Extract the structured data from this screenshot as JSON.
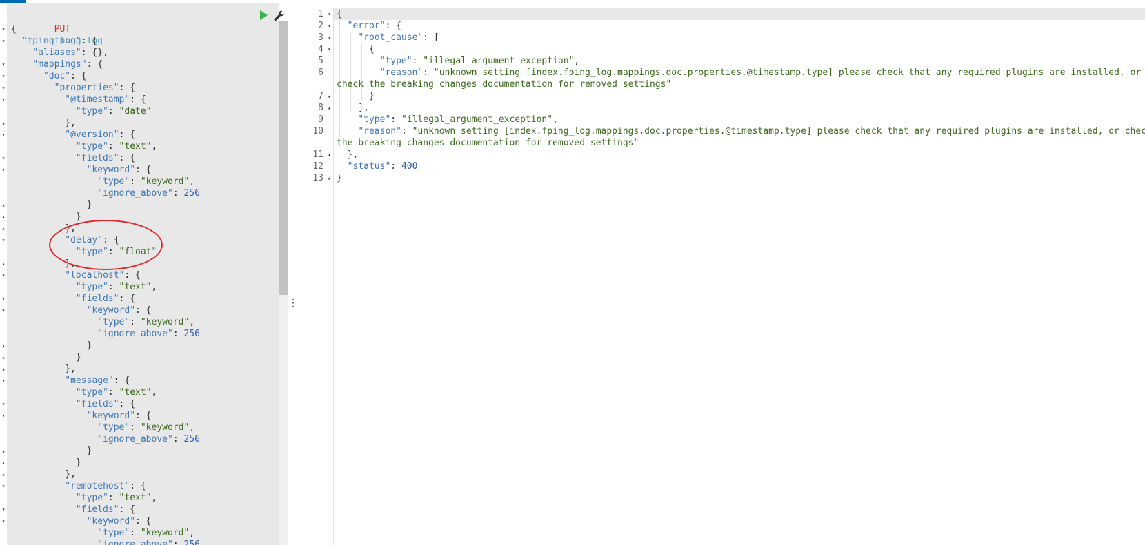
{
  "request": {
    "method": "PUT",
    "path": "fping_log",
    "run_icon": "play-icon",
    "settings_icon": "wrench-icon",
    "lines": [
      {
        "fold": "open",
        "parts": [
          [
            "p",
            "{"
          ]
        ]
      },
      {
        "fold": "open",
        "parts": [
          [
            "p",
            "  "
          ],
          [
            "k",
            "\"fping_log\""
          ],
          [
            "p",
            ": {"
          ]
        ]
      },
      {
        "fold": "",
        "parts": [
          [
            "p",
            "    "
          ],
          [
            "k",
            "\"aliases\""
          ],
          [
            "p",
            ": {},"
          ]
        ]
      },
      {
        "fold": "open",
        "parts": [
          [
            "p",
            "    "
          ],
          [
            "k",
            "\"mappings\""
          ],
          [
            "p",
            ": {"
          ]
        ]
      },
      {
        "fold": "open",
        "parts": [
          [
            "p",
            "      "
          ],
          [
            "k",
            "\"doc\""
          ],
          [
            "p",
            ": {"
          ]
        ]
      },
      {
        "fold": "open",
        "parts": [
          [
            "p",
            "        "
          ],
          [
            "k",
            "\"properties\""
          ],
          [
            "p",
            ": {"
          ]
        ]
      },
      {
        "fold": "open",
        "parts": [
          [
            "p",
            "          "
          ],
          [
            "k",
            "\"@timestamp\""
          ],
          [
            "p",
            ": {"
          ]
        ]
      },
      {
        "fold": "",
        "parts": [
          [
            "p",
            "            "
          ],
          [
            "k",
            "\"type\""
          ],
          [
            "p",
            ": "
          ],
          [
            "s",
            "\"date\""
          ]
        ]
      },
      {
        "fold": "close",
        "parts": [
          [
            "p",
            "          },"
          ]
        ]
      },
      {
        "fold": "open",
        "parts": [
          [
            "p",
            "          "
          ],
          [
            "k",
            "\"@version\""
          ],
          [
            "p",
            ": {"
          ]
        ]
      },
      {
        "fold": "",
        "parts": [
          [
            "p",
            "            "
          ],
          [
            "k",
            "\"type\""
          ],
          [
            "p",
            ": "
          ],
          [
            "s",
            "\"text\""
          ],
          [
            "p",
            ","
          ]
        ]
      },
      {
        "fold": "open",
        "parts": [
          [
            "p",
            "            "
          ],
          [
            "k",
            "\"fields\""
          ],
          [
            "p",
            ": {"
          ]
        ]
      },
      {
        "fold": "open",
        "parts": [
          [
            "p",
            "              "
          ],
          [
            "k",
            "\"keyword\""
          ],
          [
            "p",
            ": {"
          ]
        ]
      },
      {
        "fold": "",
        "parts": [
          [
            "p",
            "                "
          ],
          [
            "k",
            "\"type\""
          ],
          [
            "p",
            ": "
          ],
          [
            "s",
            "\"keyword\""
          ],
          [
            "p",
            ","
          ]
        ]
      },
      {
        "fold": "",
        "parts": [
          [
            "p",
            "                "
          ],
          [
            "k",
            "\"ignore_above\""
          ],
          [
            "p",
            ": "
          ],
          [
            "n",
            "256"
          ]
        ]
      },
      {
        "fold": "close",
        "parts": [
          [
            "p",
            "              }"
          ]
        ]
      },
      {
        "fold": "close",
        "parts": [
          [
            "p",
            "            }"
          ]
        ]
      },
      {
        "fold": "close",
        "parts": [
          [
            "p",
            "          },"
          ]
        ]
      },
      {
        "fold": "open",
        "parts": [
          [
            "p",
            "          "
          ],
          [
            "k",
            "\"delay\""
          ],
          [
            "p",
            ": {"
          ]
        ]
      },
      {
        "fold": "",
        "parts": [
          [
            "p",
            "            "
          ],
          [
            "k",
            "\"type\""
          ],
          [
            "p",
            ": "
          ],
          [
            "s",
            "\"float\""
          ]
        ]
      },
      {
        "fold": "close",
        "parts": [
          [
            "p",
            "          },"
          ]
        ]
      },
      {
        "fold": "open",
        "parts": [
          [
            "p",
            "          "
          ],
          [
            "k",
            "\"localhost\""
          ],
          [
            "p",
            ": {"
          ]
        ]
      },
      {
        "fold": "",
        "parts": [
          [
            "p",
            "            "
          ],
          [
            "k",
            "\"type\""
          ],
          [
            "p",
            ": "
          ],
          [
            "s",
            "\"text\""
          ],
          [
            "p",
            ","
          ]
        ]
      },
      {
        "fold": "open",
        "parts": [
          [
            "p",
            "            "
          ],
          [
            "k",
            "\"fields\""
          ],
          [
            "p",
            ": {"
          ]
        ]
      },
      {
        "fold": "open",
        "parts": [
          [
            "p",
            "              "
          ],
          [
            "k",
            "\"keyword\""
          ],
          [
            "p",
            ": {"
          ]
        ]
      },
      {
        "fold": "",
        "parts": [
          [
            "p",
            "                "
          ],
          [
            "k",
            "\"type\""
          ],
          [
            "p",
            ": "
          ],
          [
            "s",
            "\"keyword\""
          ],
          [
            "p",
            ","
          ]
        ]
      },
      {
        "fold": "",
        "parts": [
          [
            "p",
            "                "
          ],
          [
            "k",
            "\"ignore_above\""
          ],
          [
            "p",
            ": "
          ],
          [
            "n",
            "256"
          ]
        ]
      },
      {
        "fold": "close",
        "parts": [
          [
            "p",
            "              }"
          ]
        ]
      },
      {
        "fold": "close",
        "parts": [
          [
            "p",
            "            }"
          ]
        ]
      },
      {
        "fold": "close",
        "parts": [
          [
            "p",
            "          },"
          ]
        ]
      },
      {
        "fold": "open",
        "parts": [
          [
            "p",
            "          "
          ],
          [
            "k",
            "\"message\""
          ],
          [
            "p",
            ": {"
          ]
        ]
      },
      {
        "fold": "",
        "parts": [
          [
            "p",
            "            "
          ],
          [
            "k",
            "\"type\""
          ],
          [
            "p",
            ": "
          ],
          [
            "s",
            "\"text\""
          ],
          [
            "p",
            ","
          ]
        ]
      },
      {
        "fold": "open",
        "parts": [
          [
            "p",
            "            "
          ],
          [
            "k",
            "\"fields\""
          ],
          [
            "p",
            ": {"
          ]
        ]
      },
      {
        "fold": "open",
        "parts": [
          [
            "p",
            "              "
          ],
          [
            "k",
            "\"keyword\""
          ],
          [
            "p",
            ": {"
          ]
        ]
      },
      {
        "fold": "",
        "parts": [
          [
            "p",
            "                "
          ],
          [
            "k",
            "\"type\""
          ],
          [
            "p",
            ": "
          ],
          [
            "s",
            "\"keyword\""
          ],
          [
            "p",
            ","
          ]
        ]
      },
      {
        "fold": "",
        "parts": [
          [
            "p",
            "                "
          ],
          [
            "k",
            "\"ignore_above\""
          ],
          [
            "p",
            ": "
          ],
          [
            "n",
            "256"
          ]
        ]
      },
      {
        "fold": "close",
        "parts": [
          [
            "p",
            "              }"
          ]
        ]
      },
      {
        "fold": "close",
        "parts": [
          [
            "p",
            "            }"
          ]
        ]
      },
      {
        "fold": "close",
        "parts": [
          [
            "p",
            "          },"
          ]
        ]
      },
      {
        "fold": "open",
        "parts": [
          [
            "p",
            "          "
          ],
          [
            "k",
            "\"remotehost\""
          ],
          [
            "p",
            ": {"
          ]
        ]
      },
      {
        "fold": "",
        "parts": [
          [
            "p",
            "            "
          ],
          [
            "k",
            "\"type\""
          ],
          [
            "p",
            ": "
          ],
          [
            "s",
            "\"text\""
          ],
          [
            "p",
            ","
          ]
        ]
      },
      {
        "fold": "open",
        "parts": [
          [
            "p",
            "            "
          ],
          [
            "k",
            "\"fields\""
          ],
          [
            "p",
            ": {"
          ]
        ]
      },
      {
        "fold": "open",
        "parts": [
          [
            "p",
            "              "
          ],
          [
            "k",
            "\"keyword\""
          ],
          [
            "p",
            ": {"
          ]
        ]
      },
      {
        "fold": "",
        "parts": [
          [
            "p",
            "                "
          ],
          [
            "k",
            "\"type\""
          ],
          [
            "p",
            ": "
          ],
          [
            "s",
            "\"keyword\""
          ],
          [
            "p",
            ","
          ]
        ]
      },
      {
        "fold": "",
        "parts": [
          [
            "p",
            "                "
          ],
          [
            "k",
            "\"ignore_above\""
          ],
          [
            "p",
            ": "
          ],
          [
            "n",
            "256"
          ]
        ]
      }
    ]
  },
  "response": {
    "lines": [
      {
        "num": "1",
        "fold": "open",
        "parts": [
          [
            "p",
            "{"
          ]
        ]
      },
      {
        "num": "2",
        "fold": "open",
        "parts": [
          [
            "p",
            "  "
          ],
          [
            "k",
            "\"error\""
          ],
          [
            "p",
            ": {"
          ]
        ]
      },
      {
        "num": "3",
        "fold": "open",
        "parts": [
          [
            "p",
            "    "
          ],
          [
            "k",
            "\"root_cause\""
          ],
          [
            "p",
            ": ["
          ]
        ]
      },
      {
        "num": "4",
        "fold": "open",
        "parts": [
          [
            "p",
            "      {"
          ]
        ]
      },
      {
        "num": "5",
        "fold": "",
        "parts": [
          [
            "p",
            "        "
          ],
          [
            "k",
            "\"type\""
          ],
          [
            "p",
            ": "
          ],
          [
            "s",
            "\"illegal_argument_exception\""
          ],
          [
            "p",
            ","
          ]
        ]
      },
      {
        "num": "6",
        "fold": "",
        "parts": [
          [
            "p",
            "        "
          ],
          [
            "k",
            "\"reason\""
          ],
          [
            "p",
            ": "
          ],
          [
            "s",
            "\"unknown setting [index.fping_log.mappings.doc.properties.@timestamp.type] please check that any required plugins are installed, or"
          ]
        ]
      },
      {
        "num": "",
        "fold": "",
        "parts": [
          [
            "s",
            "check the breaking changes documentation for removed settings\""
          ]
        ]
      },
      {
        "num": "7",
        "fold": "close",
        "parts": [
          [
            "p",
            "      }"
          ]
        ]
      },
      {
        "num": "8",
        "fold": "close",
        "parts": [
          [
            "p",
            "    ],"
          ]
        ]
      },
      {
        "num": "9",
        "fold": "",
        "parts": [
          [
            "p",
            "    "
          ],
          [
            "k",
            "\"type\""
          ],
          [
            "p",
            ": "
          ],
          [
            "s",
            "\"illegal_argument_exception\""
          ],
          [
            "p",
            ","
          ]
        ]
      },
      {
        "num": "10",
        "fold": "",
        "parts": [
          [
            "p",
            "    "
          ],
          [
            "k",
            "\"reason\""
          ],
          [
            "p",
            ": "
          ],
          [
            "s",
            "\"unknown setting [index.fping_log.mappings.doc.properties.@timestamp.type] please check that any required plugins are installed, or check"
          ]
        ]
      },
      {
        "num": "",
        "fold": "",
        "parts": [
          [
            "s",
            "the breaking changes documentation for removed settings\""
          ]
        ]
      },
      {
        "num": "11",
        "fold": "close",
        "parts": [
          [
            "p",
            "  },"
          ]
        ]
      },
      {
        "num": "12",
        "fold": "",
        "parts": [
          [
            "p",
            "  "
          ],
          [
            "k",
            "\"status\""
          ],
          [
            "p",
            ": "
          ],
          [
            "n",
            "400"
          ]
        ]
      },
      {
        "num": "13",
        "fold": "close",
        "parts": [
          [
            "p",
            "}"
          ]
        ]
      }
    ]
  },
  "colors": {
    "key": "#4078b5",
    "string": "#3d6a1f",
    "number": "#2a5db0",
    "method": "#c0392b",
    "annotation": "#e0262b"
  }
}
